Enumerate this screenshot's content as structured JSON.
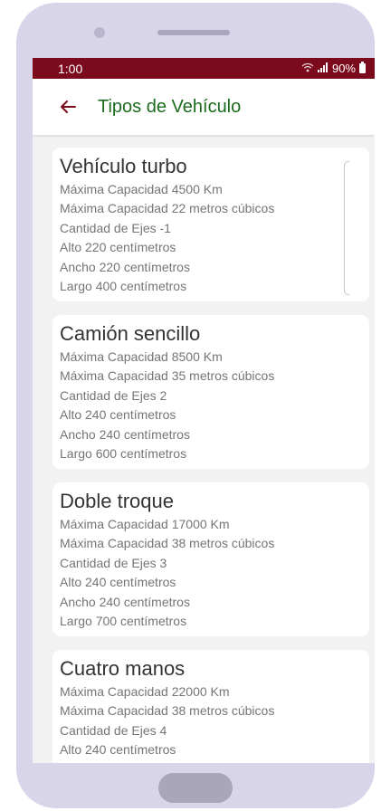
{
  "status": {
    "time": "1:00",
    "battery": "90%"
  },
  "appbar": {
    "title": "Tipos de Vehículo"
  },
  "vehicles": [
    {
      "name": "Vehículo turbo",
      "capacity_km": "Máxima Capacidad 4500 Km",
      "capacity_volume": "Máxima Capacidad 22 metros cúbicos",
      "axles": "Cantidad de Ejes -1",
      "height": "Alto 220 centímetros",
      "width": "Ancho 220 centímetros",
      "length": "Largo 400 centímetros"
    },
    {
      "name": "Camión sencillo",
      "capacity_km": "Máxima Capacidad 8500 Km",
      "capacity_volume": "Máxima Capacidad 35 metros cúbicos",
      "axles": "Cantidad de Ejes 2",
      "height": "Alto 240 centímetros",
      "width": "Ancho 240 centímetros",
      "length": "Largo 600 centímetros"
    },
    {
      "name": "Doble troque",
      "capacity_km": "Máxima Capacidad 17000 Km",
      "capacity_volume": "Máxima Capacidad 38 metros cúbicos",
      "axles": "Cantidad de Ejes 3",
      "height": "Alto 240 centímetros",
      "width": "Ancho 240 centímetros",
      "length": "Largo 700 centímetros"
    },
    {
      "name": "Cuatro manos",
      "capacity_km": "Máxima Capacidad 22000 Km",
      "capacity_volume": "Máxima Capacidad 38 metros cúbicos",
      "axles": "Cantidad de Ejes 4",
      "height": "Alto 240 centímetros"
    }
  ],
  "colors": {
    "status_bar": "#7b0a1c",
    "back_arrow": "#7b0a1c",
    "title": "#1b6b1f",
    "frame": "#d8d5ea"
  },
  "icons": {
    "back": "arrow-left-icon",
    "wifi": "wifi-icon",
    "signal": "signal-icon",
    "battery": "battery-icon"
  }
}
